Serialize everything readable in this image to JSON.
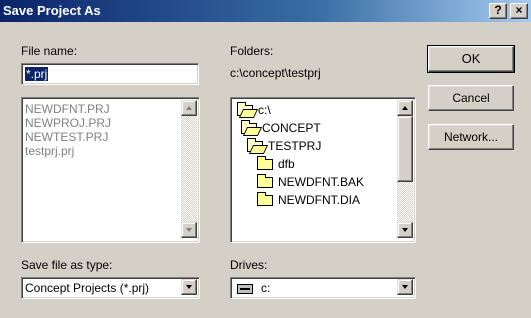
{
  "dialog": {
    "title": "Save Project As",
    "help_label": "?",
    "close_label": "×"
  },
  "filename": {
    "label": "File name:",
    "value": "*.prj",
    "files": [
      "NEWDFNT.PRJ",
      "NEWPROJ.PRJ",
      "NEWTEST.PRJ",
      "testprj.prj"
    ]
  },
  "folders": {
    "label": "Folders:",
    "current_path": "c:\\concept\\testprj",
    "items": [
      "c:\\",
      "CONCEPT",
      "TESTPRJ",
      "dfb",
      "NEWDFNT.BAK",
      "NEWDFNT.DIA"
    ]
  },
  "save_type": {
    "label": "Save file as type:",
    "selected": "Concept Projects (*.prj)"
  },
  "drives": {
    "label": "Drives:",
    "selected": "c:"
  },
  "buttons": {
    "ok": "OK",
    "cancel": "Cancel",
    "network": "Network..."
  },
  "colors": {
    "title_bar": "#0a246a",
    "selection": "#0a246a",
    "face": "#d4d0c8"
  }
}
